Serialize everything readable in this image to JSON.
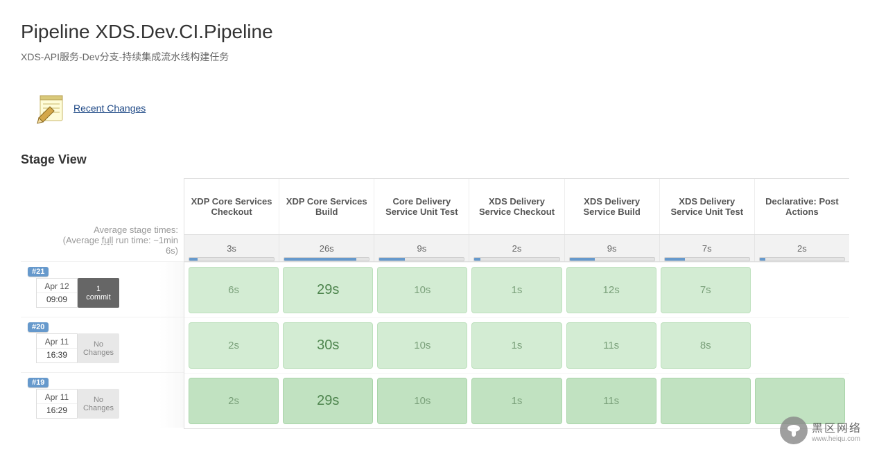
{
  "title": "Pipeline XDS.Dev.CI.Pipeline",
  "subtitle": "XDS-API服务-Dev分支-持续集成流水线构建任务",
  "recentChangesLabel": "Recent Changes",
  "stageViewHeading": "Stage View",
  "avgHeader": {
    "line1": "Average stage times:",
    "line2_pre": "(Average ",
    "line2_full": "full",
    "line2_post": " run time: ~1min",
    "line3": "6s)"
  },
  "stages": [
    {
      "name": "XDP Core Services Checkout",
      "avg": "3s",
      "bar": 10
    },
    {
      "name": "XDP Core Services Build",
      "avg": "26s",
      "bar": 85
    },
    {
      "name": "Core Delivery Service Unit Test",
      "avg": "9s",
      "bar": 30
    },
    {
      "name": "XDS Delivery Service Checkout",
      "avg": "2s",
      "bar": 7
    },
    {
      "name": "XDS Delivery Service Build",
      "avg": "9s",
      "bar": 30
    },
    {
      "name": "XDS Delivery Service Unit Test",
      "avg": "7s",
      "bar": 24
    },
    {
      "name": "Declarative: Post Actions",
      "avg": "2s",
      "bar": 7
    }
  ],
  "runs": [
    {
      "id": "#21",
      "date": "Apr 12",
      "time": "09:09",
      "commit": "1",
      "commitLabel": "commit",
      "hasChanges": true,
      "cells": [
        "6s",
        "29s",
        "10s",
        "1s",
        "12s",
        "7s",
        ""
      ],
      "strongIdx": 1,
      "darker": false
    },
    {
      "id": "#20",
      "date": "Apr 11",
      "time": "16:39",
      "commit": "No",
      "commitLabel": "Changes",
      "hasChanges": false,
      "cells": [
        "2s",
        "30s",
        "10s",
        "1s",
        "11s",
        "8s",
        ""
      ],
      "strongIdx": 1,
      "darker": false
    },
    {
      "id": "#19",
      "date": "Apr 11",
      "time": "16:29",
      "commit": "No",
      "commitLabel": "Changes",
      "hasChanges": false,
      "cells": [
        "2s",
        "29s",
        "10s",
        "1s",
        "11s",
        "",
        ""
      ],
      "strongIdx": 1,
      "darker": true
    }
  ],
  "watermark": {
    "text": "黑区网络",
    "sub": "www.heiqu.com"
  }
}
